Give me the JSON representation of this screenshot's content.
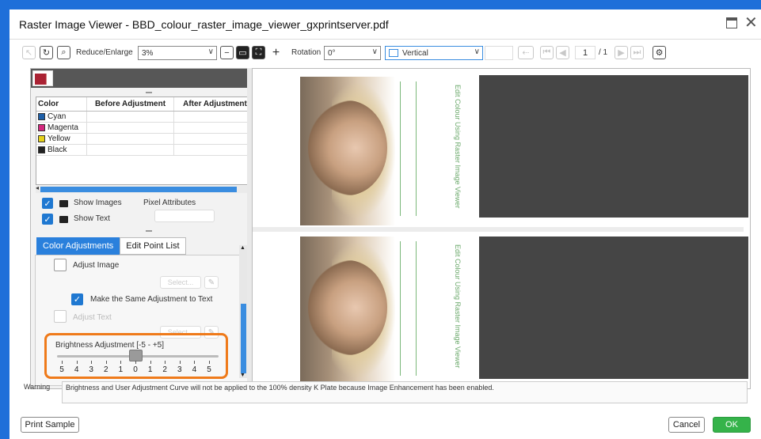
{
  "window": {
    "title": "Raster Image Viewer - BBD_colour_raster_image_viewer_gxprintserver.pdf"
  },
  "toolbar": {
    "reduce_label": "Reduce/Enlarge",
    "zoom_value": "3%",
    "rotation_label": "Rotation",
    "rotation_value": "0°",
    "orientation_value": "Vertical",
    "page_current": "1",
    "page_total": "/ 1"
  },
  "color_table": {
    "headers": [
      "Color",
      "Before Adjustment",
      "After Adjustment"
    ],
    "rows": [
      {
        "name": "Cyan",
        "color": "#1e5fa8"
      },
      {
        "name": "Magenta",
        "color": "#d4287e"
      },
      {
        "name": "Yellow",
        "color": "#e6d21a"
      },
      {
        "name": "Black",
        "color": "#222222"
      }
    ]
  },
  "options": {
    "show_images": "Show Images",
    "pixel_attributes": "Pixel Attributes",
    "show_text": "Show Text"
  },
  "tabs": {
    "color_adjustments": "Color Adjustments",
    "edit_point_list": "Edit Point List"
  },
  "adjust": {
    "adjust_image": "Adjust Image",
    "select_label": "Select...",
    "same_adjust_text": "Make the Same Adjustment to Text",
    "adjust_text": "Adjust Text"
  },
  "brightness": {
    "label": "Brightness Adjustment [-5 - +5]",
    "value": 0,
    "min": -5,
    "max": 5,
    "ticks": [
      "5",
      "4",
      "3",
      "2",
      "1",
      "0",
      "1",
      "2",
      "3",
      "4",
      "5"
    ]
  },
  "warning": {
    "label": "Warning",
    "text": "Brightness and User Adjustment Curve will not be applied to the 100% density K Plate because Image Enhancement has been enabled."
  },
  "pages": {
    "top_heading": "Edit Colour Using Raster Image Viewer",
    "bottom_heading": "Edit Colour Using Raster Image Viewer"
  },
  "buttons": {
    "print_sample": "Print Sample",
    "cancel": "Cancel",
    "ok": "OK"
  }
}
